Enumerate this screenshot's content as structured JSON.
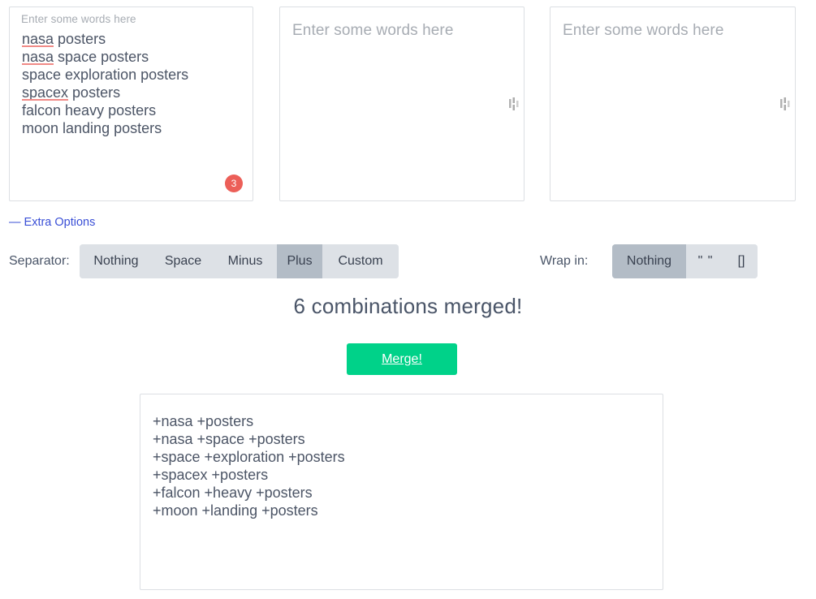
{
  "inputs": [
    {
      "name": "keywords-column-1",
      "label": "Enter some words here",
      "placeholder": "Enter some words here",
      "lines": [
        {
          "text": "nasa posters",
          "misspelled": "nasa"
        },
        {
          "text": "nasa space posters",
          "misspelled": "nasa"
        },
        {
          "text": "space exploration posters",
          "misspelled": ""
        },
        {
          "text": "spacex posters",
          "misspelled": "spacex"
        },
        {
          "text": "falcon heavy posters",
          "misspelled": ""
        },
        {
          "text": "moon landing posters",
          "misspelled": ""
        }
      ],
      "badge": "3",
      "has_grip": false
    },
    {
      "name": "keywords-column-2",
      "label": "",
      "placeholder": "Enter some words here",
      "lines": [],
      "badge": "",
      "has_grip": true
    },
    {
      "name": "keywords-column-3",
      "label": "",
      "placeholder": "Enter some words here",
      "lines": [],
      "badge": "",
      "has_grip": true
    }
  ],
  "extra_options": {
    "label": "— Extra Options"
  },
  "separator": {
    "label": "Separator:",
    "options": [
      "Nothing",
      "Space",
      "Minus",
      "Plus",
      "Custom"
    ],
    "selected": "Plus"
  },
  "wrap_in": {
    "label": "Wrap in:",
    "options": [
      "Nothing",
      "\" \"",
      "[]"
    ],
    "selected": "Nothing"
  },
  "result": {
    "heading": "6 combinations merged!",
    "merge_button": "Merge!",
    "output_lines": [
      "+nasa +posters",
      "+nasa +space +posters",
      "+space +exploration +posters",
      "+spacex +posters",
      "+falcon +heavy +posters",
      "+moon +landing +posters"
    ]
  },
  "colors": {
    "accent_green": "#00d289",
    "badge_red": "#ec5f58",
    "link_blue": "#3a4fd6",
    "segment_bg": "#dde1e6",
    "segment_active": "#b3bcc6",
    "spellcheck_underline": "#f08a86",
    "text": "#4a5568"
  }
}
